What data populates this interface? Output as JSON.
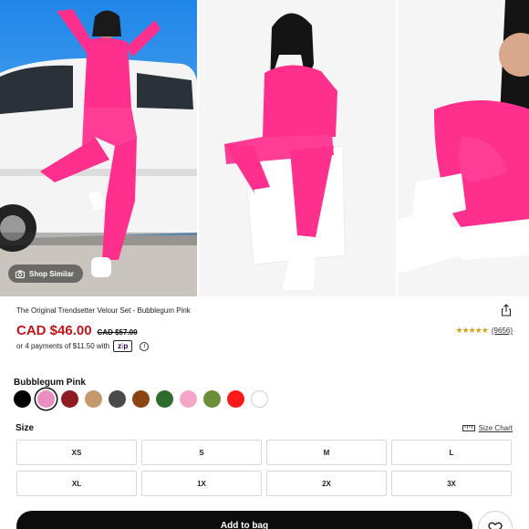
{
  "gallery": {
    "shop_similar_label": "Shop Similar"
  },
  "product": {
    "title": "The Original Trendsetter Velour Set - Bubblegum Pink",
    "price_current": "CAD $46.00",
    "price_original": "CAD $57.00",
    "rating_stars": "★★★★★",
    "rating_value": 4.5,
    "review_count": "(9656)",
    "installments_text": "or 4 payments of $11.50 with",
    "installments_provider": "zip"
  },
  "color": {
    "selected_name": "Bubblegum Pink",
    "swatches": [
      "#000000",
      "#ea8ec2",
      "#8e1a22",
      "#c49a6c",
      "#4a4a4a",
      "#8b4513",
      "#2e6b2e",
      "#f4a6c8",
      "#6b8e3a",
      "#ff1a1a",
      "#ffffff"
    ],
    "selected_index": 1
  },
  "size": {
    "label": "Size",
    "chart_label": "Size Chart",
    "options": [
      "XS",
      "S",
      "M",
      "L",
      "XL",
      "1X",
      "2X",
      "3X"
    ]
  },
  "actions": {
    "add_to_bag": "Add to bag"
  },
  "colors": {
    "accent_price": "#c0161b",
    "product_pink": "#ff2f8e",
    "button_black": "#0c0c0c"
  }
}
